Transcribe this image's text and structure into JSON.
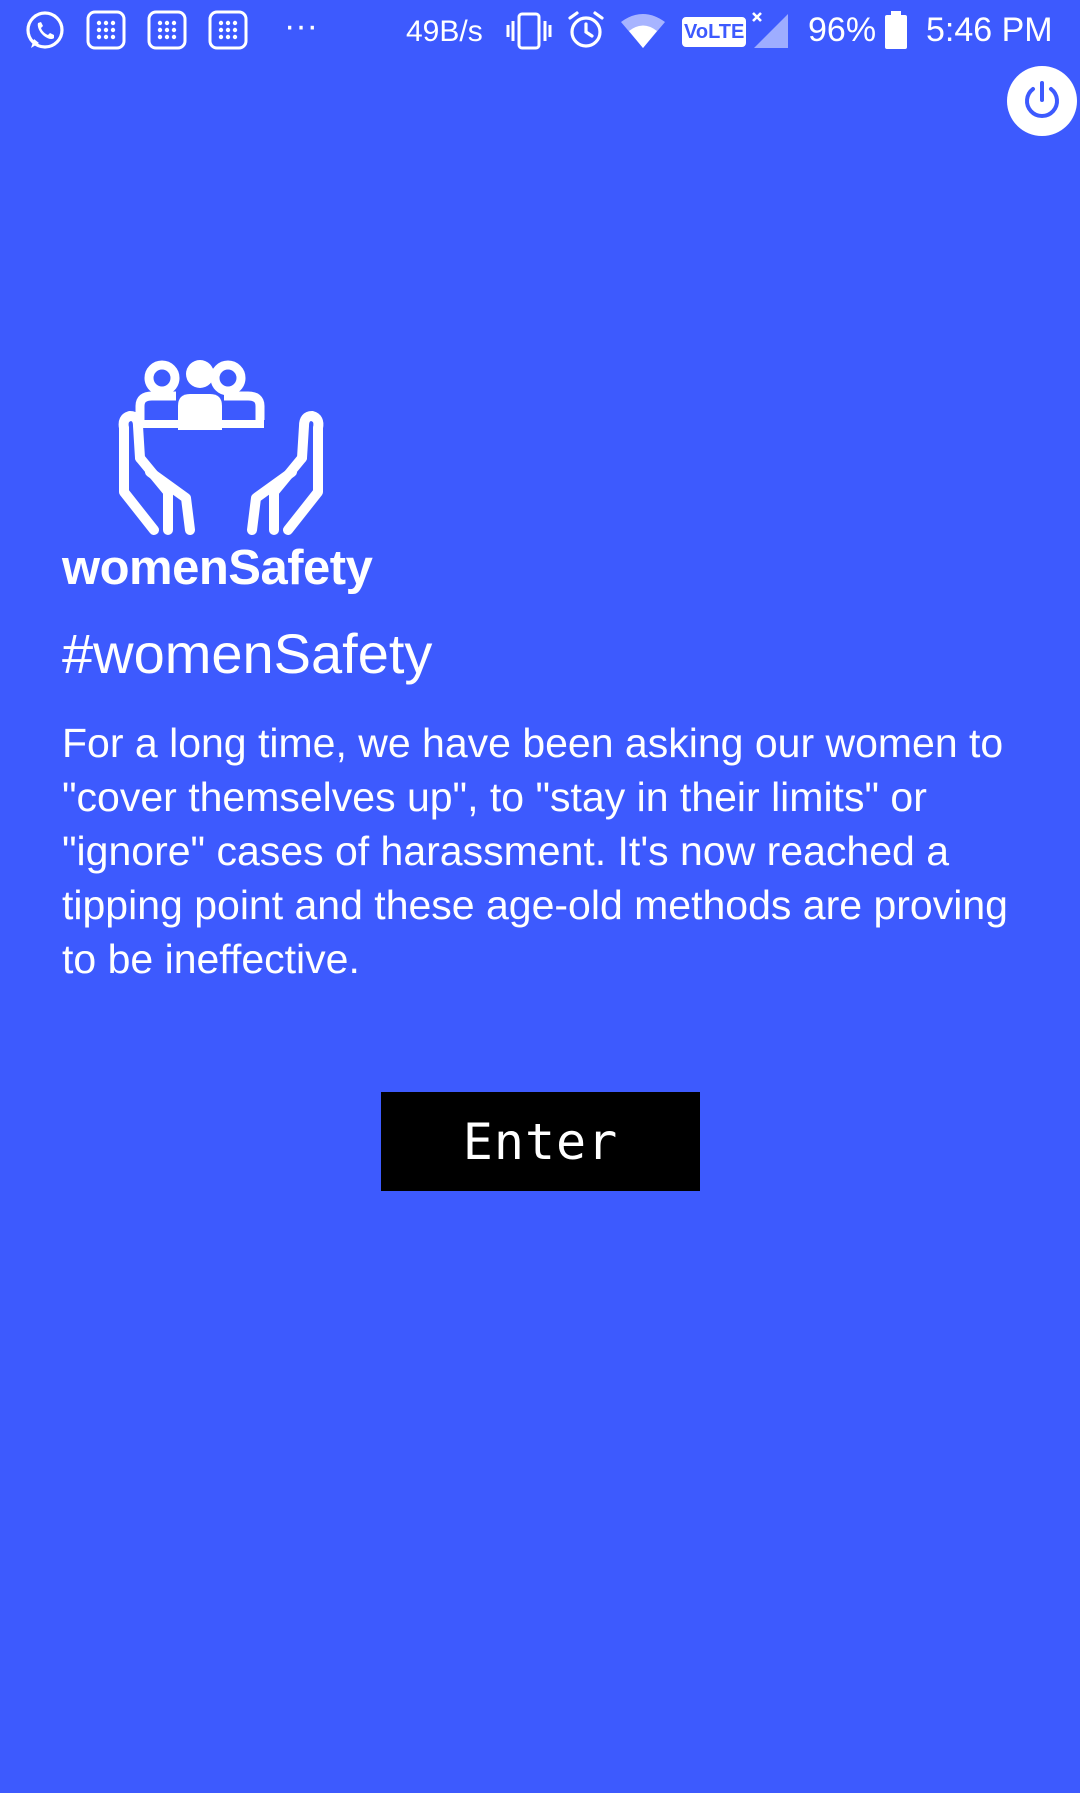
{
  "status_bar": {
    "network_speed": "49B/s",
    "volte_label": "VoLTE",
    "battery_percent": "96%",
    "time": "5:46 PM",
    "overflow": "···",
    "icons": [
      "whatsapp-icon",
      "grid-app-icon",
      "grid-app-icon",
      "grid-app-icon",
      "vibrate-icon",
      "alarm-icon",
      "wifi-icon",
      "signal-icon",
      "battery-icon"
    ]
  },
  "power": {
    "icon": "power-icon"
  },
  "logo": {
    "icon": "people-in-hands-icon",
    "brand": "womenSafety"
  },
  "content": {
    "hashtag": "#womenSafety",
    "intro": "For a long time, we have been asking our women to \"cover themselves up\", to \"stay in their limits\" or \"ignore\" cases of harassment. It's now reached a tipping point and these age-old methods are proving to be ineffective."
  },
  "actions": {
    "enter_label": "Enter"
  },
  "colors": {
    "background": "#3d5afe",
    "button": "#000000",
    "text": "#ffffff"
  }
}
